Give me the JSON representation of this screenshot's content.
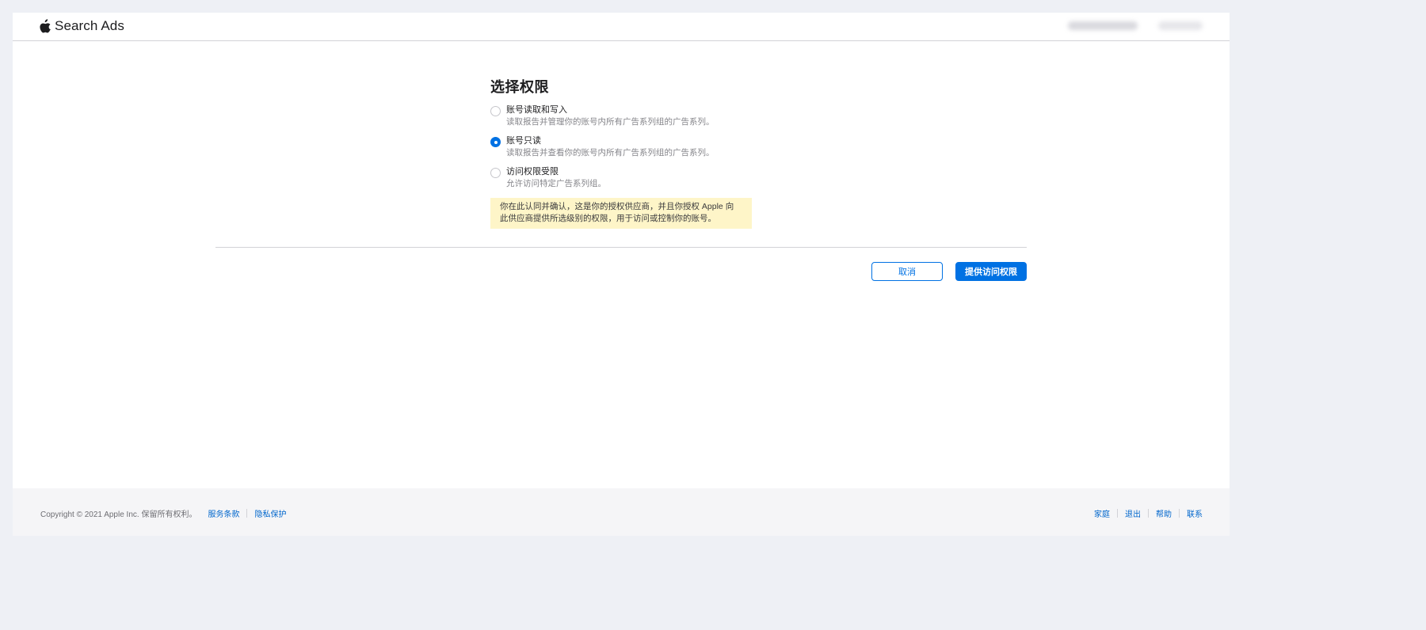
{
  "header": {
    "brand": "Search Ads",
    "logo_icon": "apple-icon"
  },
  "main": {
    "title": "选择权限",
    "options": [
      {
        "label": "账号读取和写入",
        "description": "读取报告并管理你的账号内所有广告系列组的广告系列。",
        "checked": false
      },
      {
        "label": "账号只读",
        "description": "读取报告并查看你的账号内所有广告系列组的广告系列。",
        "checked": true
      },
      {
        "label": "访问权限受限",
        "description": "允许访问特定广告系列组。",
        "checked": false
      }
    ],
    "notice_line1": "你在此认同并确认，这是你的授权供应商，并且你授权 Apple 向",
    "notice_line2": "此供应商提供所选级别的权限，用于访问或控制你的账号。"
  },
  "actions": {
    "cancel_label": "取消",
    "grant_label": "提供访问权限"
  },
  "footer": {
    "copyright": "Copyright © 2021 Apple Inc. 保留所有权利。",
    "left_links": [
      "服务条款",
      "隐私保护"
    ],
    "right_links": [
      "家庭",
      "退出",
      "帮助",
      "联系"
    ]
  },
  "colors": {
    "accent": "#0071e3",
    "notice_bg": "#fef5c8",
    "footer_bg": "#f5f5f7"
  }
}
